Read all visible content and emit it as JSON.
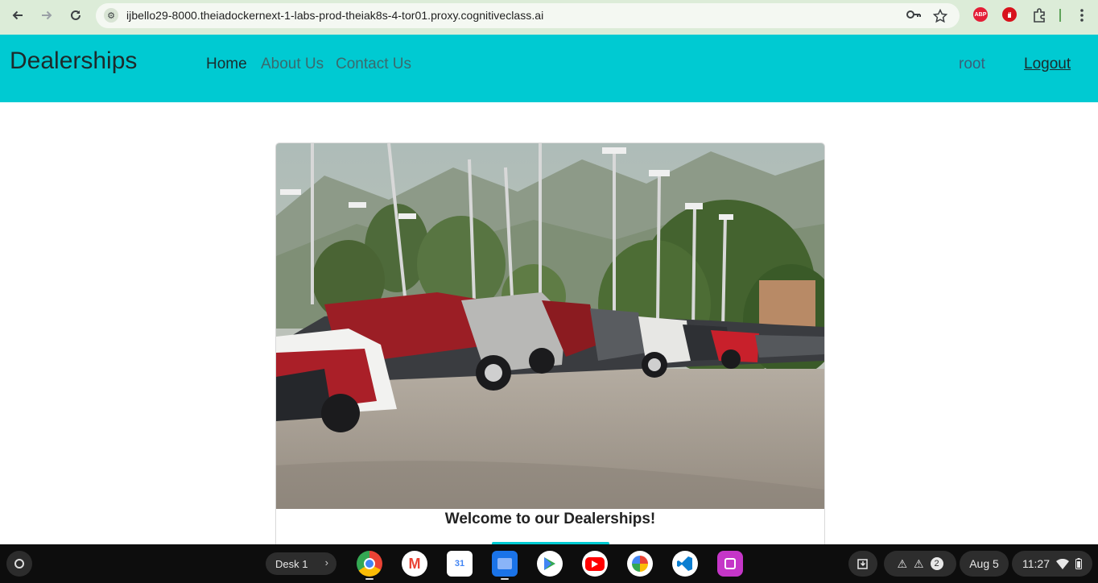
{
  "browser": {
    "url": "ijbello29-8000.theiadockernext-1-labs-prod-theiak8s-4-tor01.proxy.cognitiveclass.ai",
    "extensions": [
      "ABP"
    ]
  },
  "navbar": {
    "brand": "Dealerships",
    "links": [
      {
        "label": "Home",
        "active": true
      },
      {
        "label": "About Us",
        "active": false
      },
      {
        "label": "Contact Us",
        "active": false
      }
    ],
    "username": "root",
    "logout_label": "Logout"
  },
  "card": {
    "title": "Welcome to our Dealerships!"
  },
  "shelf": {
    "desk_label": "Desk 1",
    "notification_count": "2",
    "date": "Aug 5",
    "time": "11:27"
  },
  "colors": {
    "navbar": "#00cad2",
    "browser_bar": "#dcecd8"
  }
}
